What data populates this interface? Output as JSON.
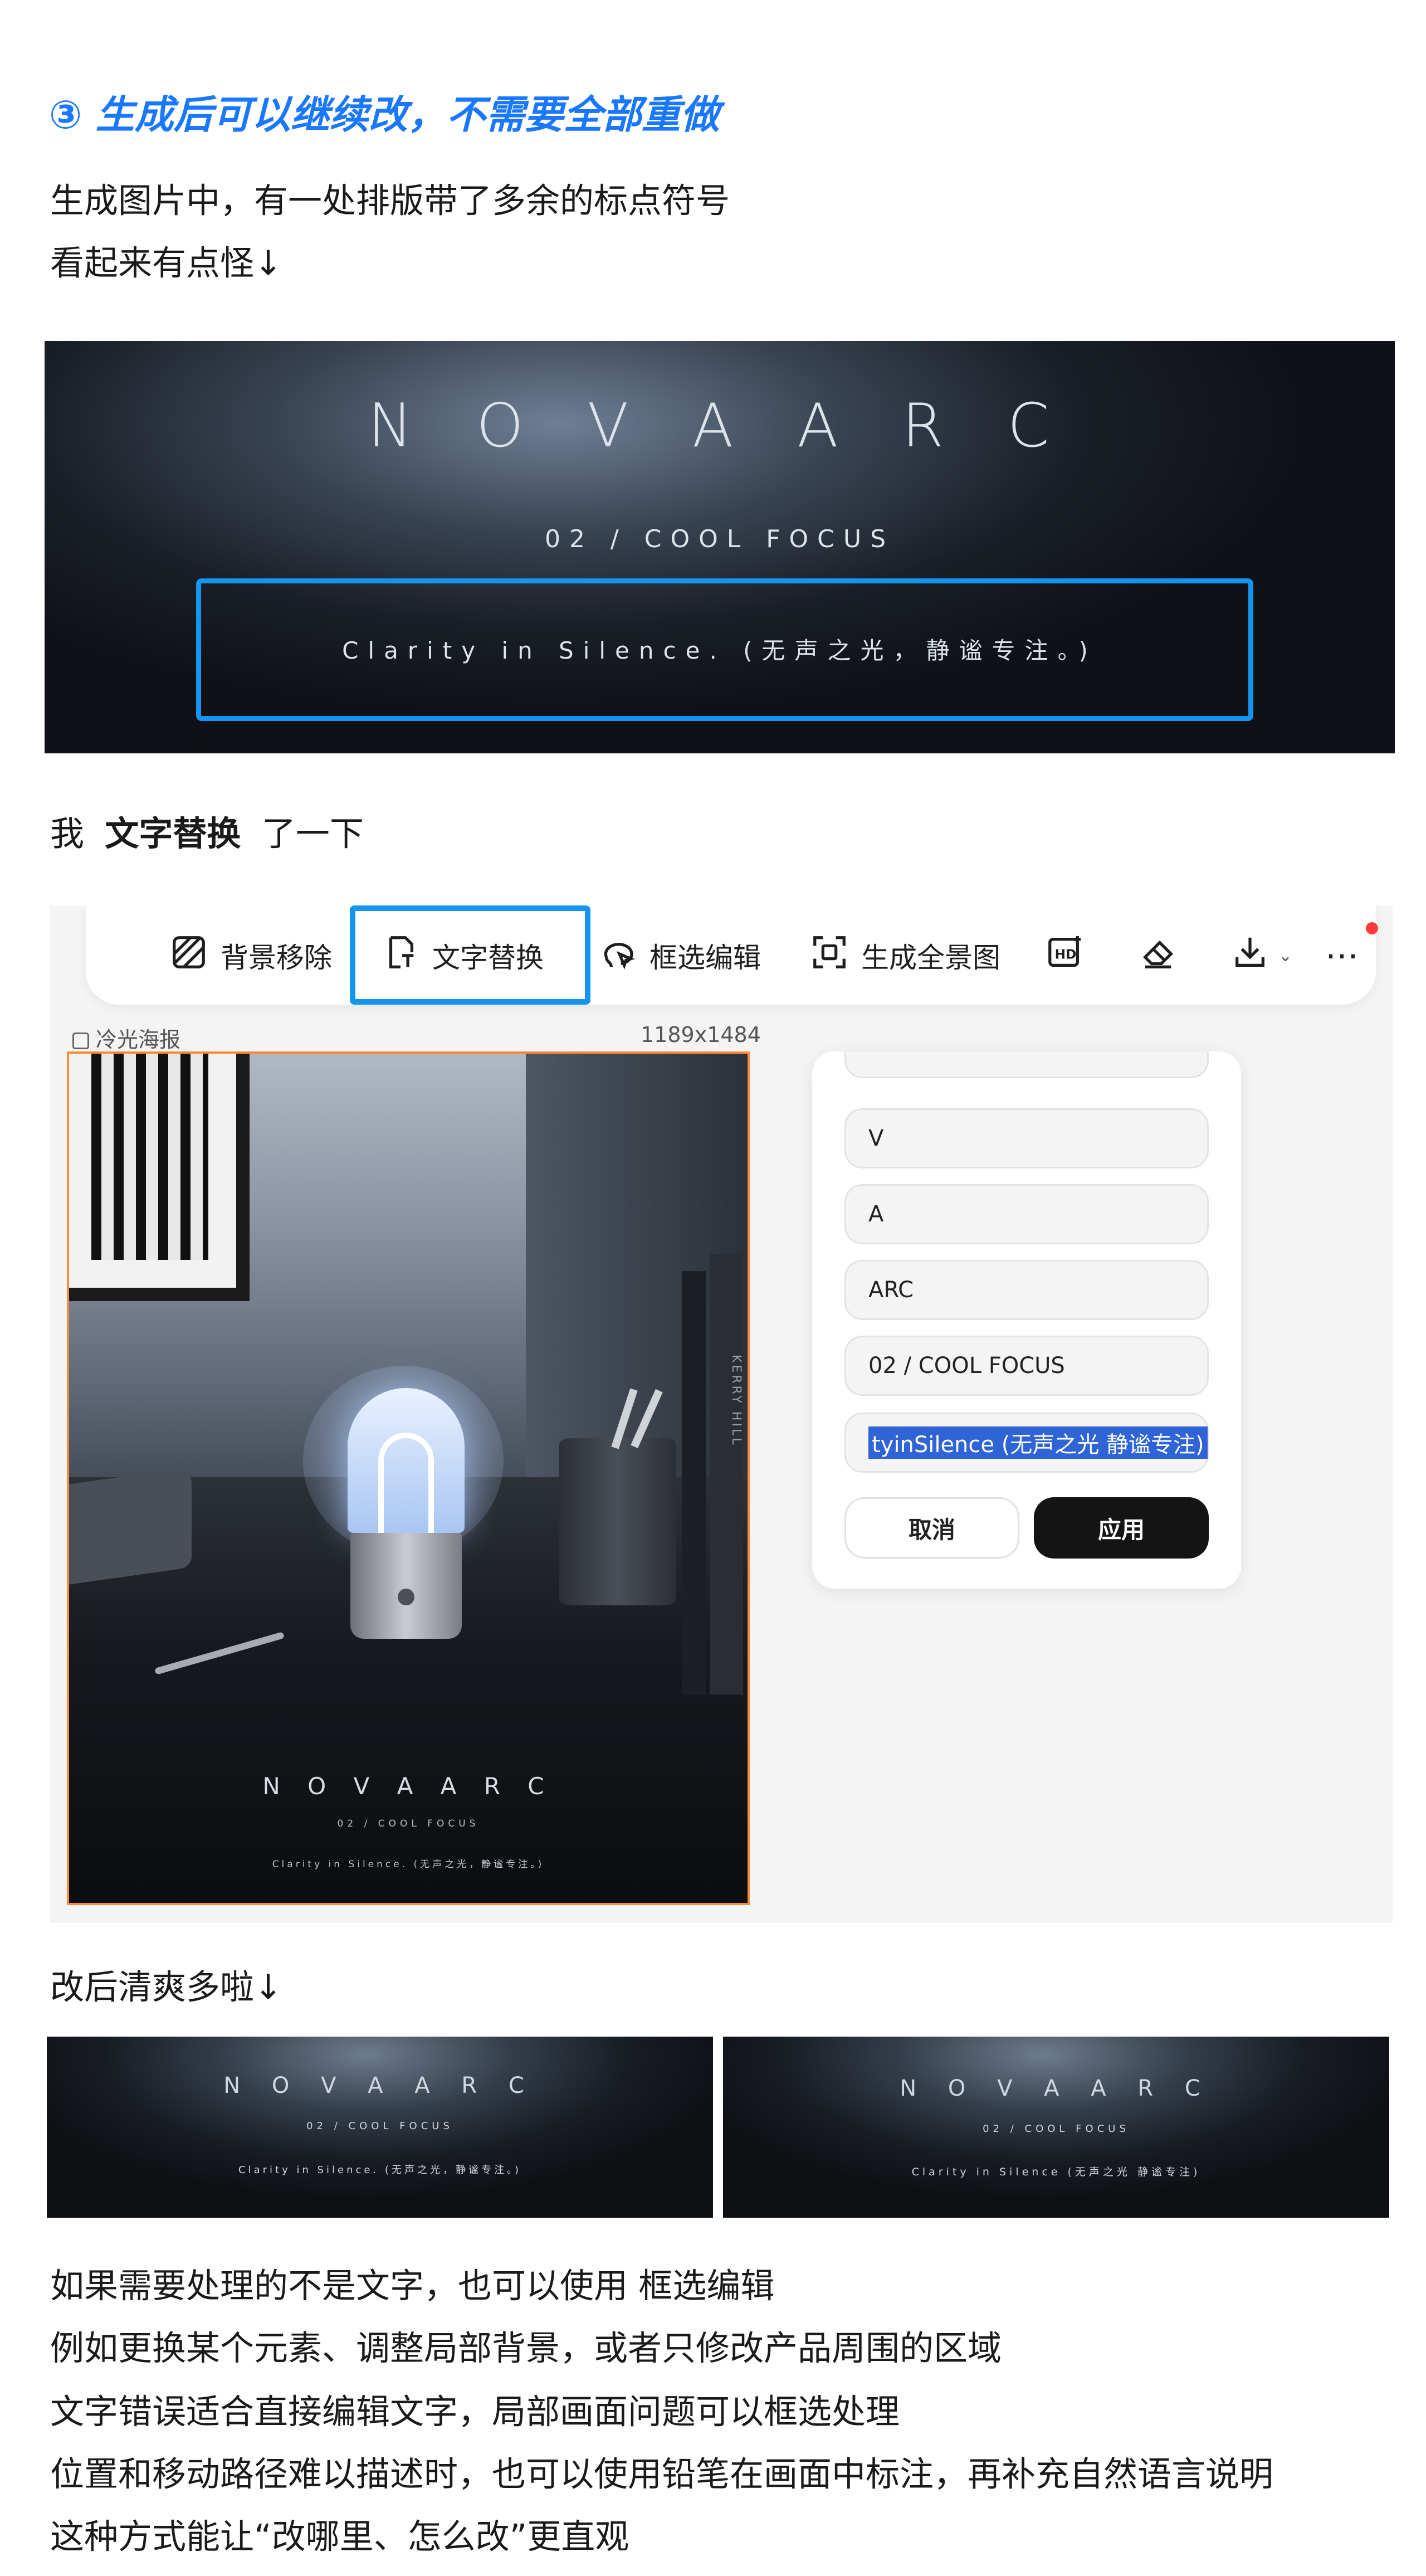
{
  "section": {
    "heading": "③ 生成后可以继续改，不需要全部重做",
    "intro_line1": "生成图片中，有一处排版带了多余的标点符号",
    "intro_line2": "看起来有点怪↓"
  },
  "banner": {
    "title": "N O V A    A R C",
    "subtitle": "02 / COOL FOCUS",
    "tagline": "Clarity in Silence. (无声之光，静谧专注。)"
  },
  "replace_line": {
    "prefix": "我",
    "bold": "文字替换",
    "suffix": "了一下"
  },
  "app": {
    "toolbar": [
      {
        "label": "背景移除",
        "icon": "background-remove-icon"
      },
      {
        "label": "文字替换",
        "icon": "text-replace-icon"
      },
      {
        "label": "框选编辑",
        "icon": "lasso-edit-icon"
      },
      {
        "label": "生成全景图",
        "icon": "panorama-icon"
      },
      {
        "label": "",
        "icon": "hd-icon"
      },
      {
        "label": "",
        "icon": "eraser-icon"
      },
      {
        "label": "",
        "icon": "download-icon"
      },
      {
        "label": "",
        "icon": "more-icon"
      }
    ],
    "image_name": "冷光海报",
    "image_size": "1189x1484",
    "poster": {
      "vertical_text": "KERRY HILL",
      "title": "N O V A   A R C",
      "subtitle": "02 / COOL FOCUS",
      "tagline": "Clarity in Silence. (无声之光，静谧专注。)"
    },
    "panel": {
      "fields": [
        "V",
        "A",
        "ARC",
        "02 / COOL FOCUS",
        "tyinSilence (无声之光 静谧专注)"
      ],
      "cancel_label": "取消",
      "apply_label": "应用"
    }
  },
  "after": {
    "caption": "改后清爽多啦↓",
    "left": {
      "title": "N O V A   A R C",
      "subtitle": "02 / COOL FOCUS",
      "tagline": "Clarity in Silence. (无声之光，静谧专注。)"
    },
    "right": {
      "title": "N O V A   A R C",
      "subtitle": "02 / COOL FOCUS",
      "tagline": "Clarity in Silence (无声之光 静谧专注)"
    }
  },
  "footer": [
    "如果需要处理的不是文字，也可以使用 框选编辑",
    "例如更换某个元素、调整局部背景，或者只修改产品周围的区域",
    "文字错误适合直接编辑文字，局部画面问题可以框选处理",
    "位置和移动路径难以描述时，也可以使用铅笔在画面中标注，再补充自然语言说明",
    "这种方式能让“改哪里、怎么改”更直观"
  ],
  "colors": {
    "accent_blue": "#1a78ff",
    "highlight_blue": "#1496f0",
    "selection_orange": "#ff8a3a",
    "apply_button": "#141414"
  }
}
